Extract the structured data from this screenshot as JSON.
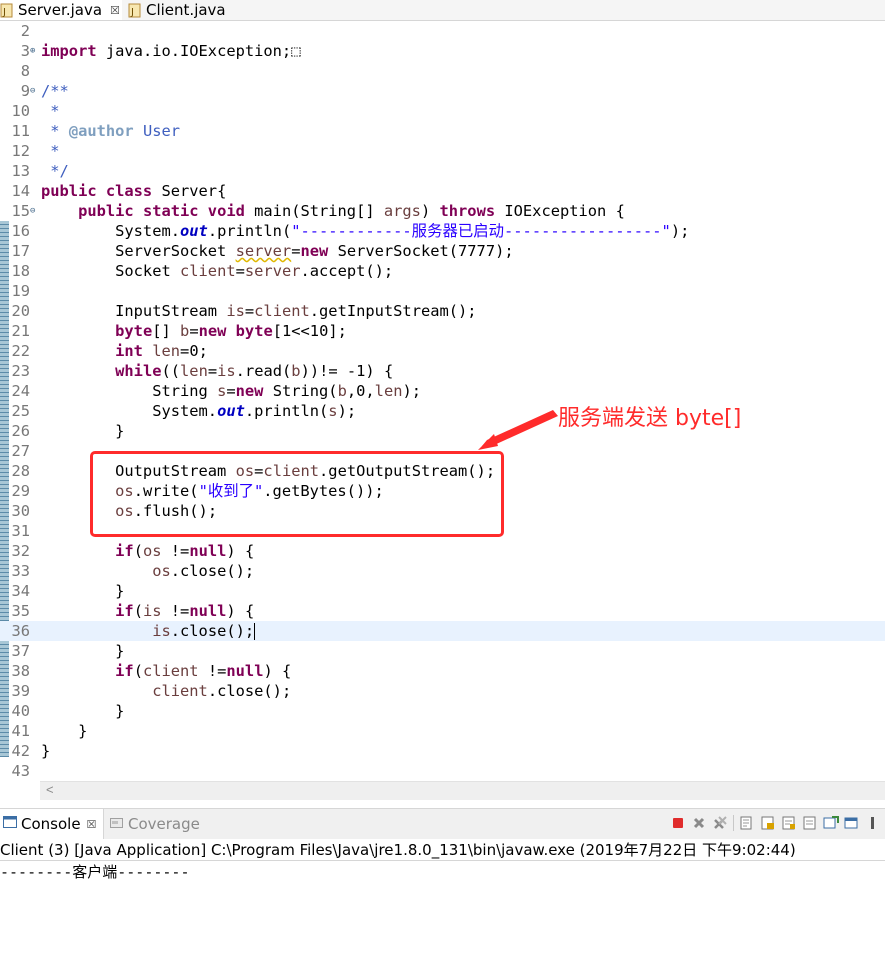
{
  "tabs": [
    {
      "label": "Server.java",
      "active": true,
      "close": "☒"
    },
    {
      "label": "Client.java",
      "active": false
    }
  ],
  "code_lines": [
    {
      "n": "2",
      "html": ""
    },
    {
      "n": "3",
      "fold": "⊕",
      "html": "<span class=\"k\">import</span> java.io.IOException;⬚"
    },
    {
      "n": "8",
      "html": ""
    },
    {
      "n": "9",
      "fold": "⊖",
      "html": "<span class=\"c\">/**</span>"
    },
    {
      "n": "10",
      "html": "<span class=\"c\"> *</span>"
    },
    {
      "n": "11",
      "html": "<span class=\"c\"> * </span><span class=\"t\">@author</span><span class=\"c\"> User</span>"
    },
    {
      "n": "12",
      "html": "<span class=\"c\"> *</span>"
    },
    {
      "n": "13",
      "html": "<span class=\"c\"> */</span>"
    },
    {
      "n": "14",
      "html": "<span class=\"k\">public class</span> Server{"
    },
    {
      "n": "15",
      "fold": "⊖",
      "html": "    <span class=\"k\">public static void</span> main(String[] <span class=\"v\">args</span>) <span class=\"k\">throws</span> IOException {"
    },
    {
      "n": "16",
      "html": "        System.<span class=\"f\">out</span>.println(<span class=\"s\">\"------------服务器已启动-----------------\"</span>);"
    },
    {
      "n": "17",
      "html": "        ServerSocket <span class=\"v sq\">server</span>=<span class=\"k\">new</span> ServerSocket(7777);"
    },
    {
      "n": "18",
      "html": "        Socket <span class=\"v\">client</span>=<span class=\"v\">server</span>.accept();"
    },
    {
      "n": "19",
      "html": ""
    },
    {
      "n": "20",
      "html": "        InputStream <span class=\"v\">is</span>=<span class=\"v\">client</span>.getInputStream();"
    },
    {
      "n": "21",
      "html": "        <span class=\"k\">byte</span>[] <span class=\"v\">b</span>=<span class=\"k\">new byte</span>[1&lt;&lt;10];"
    },
    {
      "n": "22",
      "html": "        <span class=\"k\">int</span> <span class=\"v\">len</span>=0;"
    },
    {
      "n": "23",
      "html": "        <span class=\"k\">while</span>((<span class=\"v\">len</span>=<span class=\"v\">is</span>.read(<span class=\"v\">b</span>))!= -1) {"
    },
    {
      "n": "24",
      "html": "            String <span class=\"v\">s</span>=<span class=\"k\">new</span> String(<span class=\"v\">b</span>,0,<span class=\"v\">len</span>);"
    },
    {
      "n": "25",
      "html": "            System.<span class=\"f\">out</span>.println(<span class=\"v\">s</span>);"
    },
    {
      "n": "26",
      "html": "        }"
    },
    {
      "n": "27",
      "html": ""
    },
    {
      "n": "28",
      "html": "        OutputStream <span class=\"v\">os</span>=<span class=\"v\">client</span>.getOutputStream();"
    },
    {
      "n": "29",
      "html": "        <span class=\"v\">os</span>.write(<span class=\"s\">\"收到了\"</span>.getBytes());"
    },
    {
      "n": "30",
      "html": "        <span class=\"v\">os</span>.flush();"
    },
    {
      "n": "31",
      "html": ""
    },
    {
      "n": "32",
      "html": "        <span class=\"k\">if</span>(<span class=\"v\">os</span> !=<span class=\"k\">null</span>) {"
    },
    {
      "n": "33",
      "html": "            <span class=\"v\">os</span>.close();"
    },
    {
      "n": "34",
      "html": "        }"
    },
    {
      "n": "35",
      "html": "        <span class=\"k\">if</span>(<span class=\"v\">is</span> !=<span class=\"k\">null</span>) {"
    },
    {
      "n": "36",
      "cur": true,
      "html": "            <span class=\"v\">is</span>.close();<span class=\"cursor\"></span>"
    },
    {
      "n": "37",
      "html": "        }"
    },
    {
      "n": "38",
      "html": "        <span class=\"k\">if</span>(<span class=\"v\">client</span> !=<span class=\"k\">null</span>) {"
    },
    {
      "n": "39",
      "html": "            <span class=\"v\">client</span>.close();"
    },
    {
      "n": "40",
      "html": "        }"
    },
    {
      "n": "41",
      "html": "    }"
    },
    {
      "n": "42",
      "html": "}"
    },
    {
      "n": "43",
      "html": ""
    }
  ],
  "annotation": {
    "text": "服务端发送 byte[]",
    "color": "#ff2b2b"
  },
  "console": {
    "tabs": [
      {
        "label": "Console",
        "close": "☒",
        "active": true
      },
      {
        "label": "Coverage",
        "active": false
      }
    ],
    "header": "Client (3) [Java Application] C:\\Program Files\\Java\\jre1.8.0_131\\bin\\javaw.exe (2019年7月22日 下午9:02:44)",
    "output": "--------客户端--------"
  },
  "colors": {
    "keyword": "#7f0055",
    "string": "#2a00ff",
    "comment": "#3f5fbf",
    "current_line": "#e8f2fe"
  }
}
